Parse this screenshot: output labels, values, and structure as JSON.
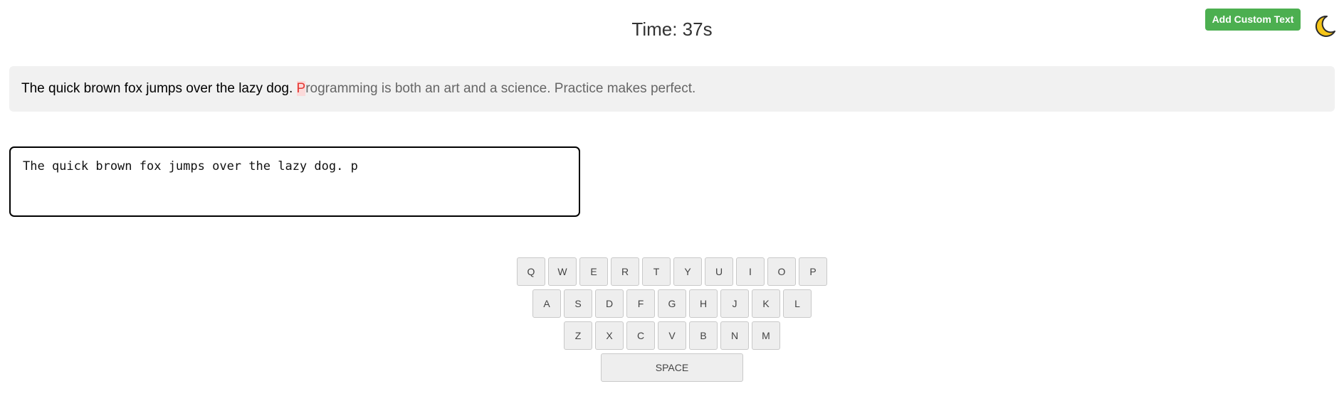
{
  "timer": {
    "text": "Time: 37s"
  },
  "toolbar": {
    "add_custom_text_label": "Add Custom Text",
    "theme_icon": "moon-icon"
  },
  "target_text": {
    "typed": "The quick brown fox jumps over the lazy dog. ",
    "current": "P",
    "remaining": "rogramming is both an art and a science. Practice makes perfect."
  },
  "input": {
    "value": "The quick brown fox jumps over the lazy dog. p"
  },
  "keyboard": {
    "rows": [
      [
        "Q",
        "W",
        "E",
        "R",
        "T",
        "Y",
        "U",
        "I",
        "O",
        "P"
      ],
      [
        "A",
        "S",
        "D",
        "F",
        "G",
        "H",
        "J",
        "K",
        "L"
      ],
      [
        "Z",
        "X",
        "C",
        "V",
        "B",
        "N",
        "M"
      ]
    ],
    "space_label": "SPACE"
  },
  "colors": {
    "accent": "#4caf50",
    "error": "#e53935",
    "error_bg": "#fbdada",
    "moon": "#f5c518"
  }
}
